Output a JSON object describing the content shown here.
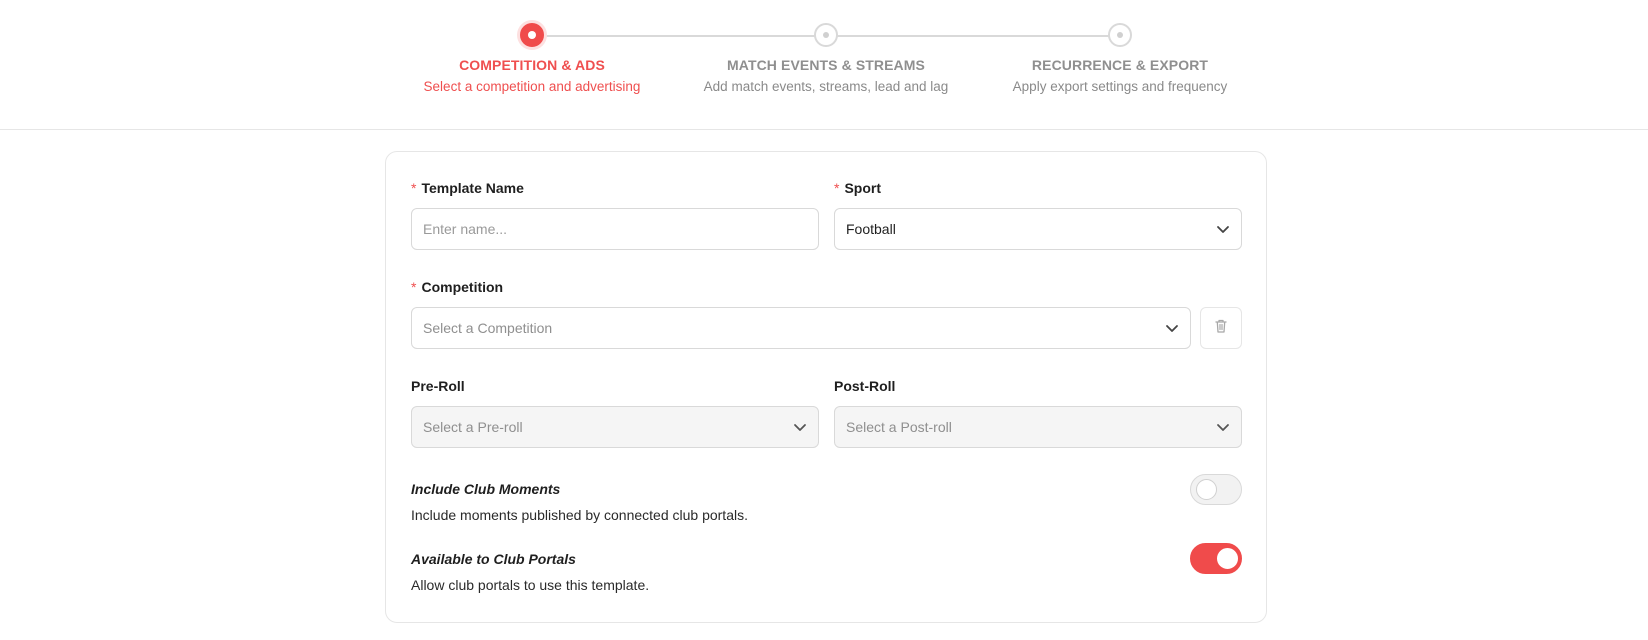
{
  "stepper": {
    "steps": [
      {
        "title": "COMPETITION & ADS",
        "subtitle": "Select a competition and advertising",
        "state": "active"
      },
      {
        "title": "MATCH EVENTS & STREAMS",
        "subtitle": "Add match events, streams, lead and lag",
        "state": "pending"
      },
      {
        "title": "RECURRENCE & EXPORT",
        "subtitle": "Apply export settings and frequency",
        "state": "pending"
      }
    ]
  },
  "form": {
    "template_name": {
      "label": "Template Name",
      "required": true,
      "value": "",
      "placeholder": "Enter name..."
    },
    "sport": {
      "label": "Sport",
      "required": true,
      "value": "Football"
    },
    "competition": {
      "label": "Competition",
      "required": true,
      "placeholder": "Select a Competition"
    },
    "pre_roll": {
      "label": "Pre-Roll",
      "placeholder": "Select a Pre-roll",
      "disabled": true
    },
    "post_roll": {
      "label": "Post-Roll",
      "placeholder": "Select a Post-roll",
      "disabled": true
    },
    "required_marker": "*",
    "toggles": [
      {
        "title": "Include Club Moments",
        "description": "Include moments published by connected club portals.",
        "on": false
      },
      {
        "title": "Available to Club Portals",
        "description": "Allow club portals to use this template.",
        "on": true
      }
    ]
  },
  "colors": {
    "accent": "#f04b4b",
    "border": "#d9d9d9",
    "muted_text": "#8f8f8f",
    "disabled_bg": "#f5f5f5"
  },
  "icons": {
    "select_arrow": "chevron-down-icon",
    "delete": "trash-icon"
  }
}
